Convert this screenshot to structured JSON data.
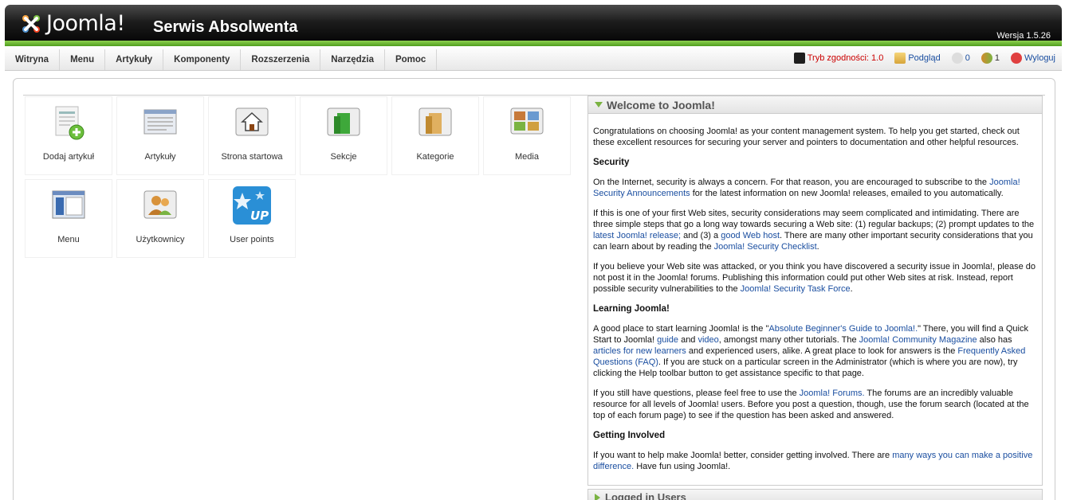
{
  "header": {
    "logo_text": "Joomla!",
    "site_title": "Serwis Absolwenta",
    "version": "Wersja 1.5.26"
  },
  "menu": [
    {
      "label": "Witryna"
    },
    {
      "label": "Menu"
    },
    {
      "label": "Artykuły"
    },
    {
      "label": "Komponenty"
    },
    {
      "label": "Rozszerzenia"
    },
    {
      "label": "Narzędzia"
    },
    {
      "label": "Pomoc"
    }
  ],
  "status": {
    "compat": "Tryb zgodności: 1.0",
    "preview": "Podgląd",
    "messages": "0",
    "users": "1",
    "logout": "Wyloguj"
  },
  "quickicons": [
    {
      "label": "Dodaj artykuł",
      "icon": "add-article-icon"
    },
    {
      "label": "Artykuły",
      "icon": "articles-icon"
    },
    {
      "label": "Strona startowa",
      "icon": "home-icon"
    },
    {
      "label": "Sekcje",
      "icon": "sections-icon"
    },
    {
      "label": "Kategorie",
      "icon": "categories-icon"
    },
    {
      "label": "Media",
      "icon": "media-icon"
    },
    {
      "label": "Menu",
      "icon": "menu-icon"
    },
    {
      "label": "Użytkownicy",
      "icon": "users-icon"
    },
    {
      "label": "User points",
      "icon": "user-points-icon"
    }
  ],
  "welcome": {
    "title": "Welcome to Joomla!",
    "intro": "Congratulations on choosing Joomla! as your content management system. To help you get started, check out these excellent resources for securing your server and pointers to documentation and other helpful resources.",
    "h_security": "Security",
    "sec1_a": "On the Internet, security is always a concern. For that reason, you are encouraged to subscribe to the ",
    "sec1_link": "Joomla! Security Announcements",
    "sec1_b": " for the latest information on new Joomla! releases, emailed to you automatically.",
    "sec2_a": "If this is one of your first Web sites, security considerations may seem complicated and intimidating. There are three simple steps that go a long way towards securing a Web site: (1) regular backups; (2) prompt updates to the ",
    "sec2_link1": "latest Joomla! release;",
    "sec2_b": " and (3) a ",
    "sec2_link2": "good Web host",
    "sec2_c": ". There are many other important security considerations that you can learn about by reading the ",
    "sec2_link3": "Joomla! Security Checklist",
    "sec2_d": ".",
    "sec3_a": "If you believe your Web site was attacked, or you think you have discovered a security issue in Joomla!, please do not post it in the Joomla! forums. Publishing this information could put other Web sites at risk. Instead, report possible security vulnerabilities to the ",
    "sec3_link": "Joomla! Security Task Force",
    "sec3_b": ".",
    "h_learning": "Learning Joomla!",
    "learn_a": "A good place to start learning Joomla! is the \"",
    "learn_link1": "Absolute Beginner's Guide to Joomla!.",
    "learn_b": "\" There, you will find a Quick Start to Joomla! ",
    "learn_link2": "guide",
    "learn_c": " and ",
    "learn_link3": "video",
    "learn_d": ", amongst many other tutorials. The ",
    "learn_link4": "Joomla! Community Magazine",
    "learn_e": " also has ",
    "learn_link5": "articles for new learners",
    "learn_f": " and experienced users, alike. A great place to look for answers is the ",
    "learn_link6": "Frequently Asked Questions (FAQ)",
    "learn_g": ". If you are stuck on a particular screen in the Administrator (which is where you are now), try clicking the Help toolbar button to get assistance specific to that page.",
    "q_a": "If you still have questions, please feel free to use the ",
    "q_link": "Joomla! Forums.",
    "q_b": " The forums are an incredibly valuable resource for all levels of Joomla! users. Before you post a question, though, use the forum search (located at the top of each forum page) to see if the question has been asked and answered.",
    "h_involved": "Getting Involved",
    "inv_a": "If you want to help make Joomla! better, consider getting involved. There are ",
    "inv_link": "many ways you can make a positive difference.",
    "inv_b": " Have fun using Joomla!."
  },
  "logged_in": {
    "title": "Logged in Users"
  }
}
